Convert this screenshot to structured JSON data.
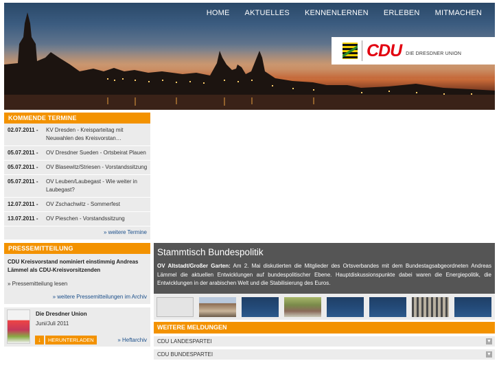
{
  "nav": [
    "HOME",
    "AKTUELLES",
    "KENNENLERNEN",
    "ERLEBEN",
    "MITMACHEN"
  ],
  "logo": {
    "brand": "CDU",
    "subtitle": "DIE DRESDNER UNION"
  },
  "colors": {
    "accent": "#f39200",
    "brand_red": "#e2000f",
    "link": "#1a4e8a",
    "panel": "#ebebeb",
    "dark_panel": "#555555"
  },
  "termine": {
    "heading": "KOMMENDE TERMINE",
    "items": [
      {
        "date": "02.07.2011 -",
        "text": "KV Dresden - Kreisparteitag mit Neuwahlen des Kreisvorstan…"
      },
      {
        "date": "05.07.2011 -",
        "text": "OV Dresdner Sueden - Ortsbeirat Plauen"
      },
      {
        "date": "05.07.2011 -",
        "text": "OV Blasewitz/Striesen - Vorstandssitzung"
      },
      {
        "date": "05.07.2011 -",
        "text": "OV Leuben/Laubegast - Wie weiter in Laubegast?"
      },
      {
        "date": "12.07.2011 -",
        "text": "OV Zschachwitz - Sommerfest"
      },
      {
        "date": "13.07.2011 -",
        "text": "OV Pieschen - Vorstandssitzung"
      }
    ],
    "more": "» weitere Termine"
  },
  "presse": {
    "heading": "PRESSEMITTEILUNG",
    "title": "CDU Kreisvorstand nominiert einstimmig Andreas Lämmel als CDU-Kreisvorsitzenden",
    "read": "» Pressemitteilung lesen",
    "more": "» weitere Pressemitteilungen im Archiv"
  },
  "magazin": {
    "title": "Die Dresdner Union",
    "issue": "Juni/Juli 2011",
    "download": "HERUNTERLADEN",
    "archive": "» Heftarchiv"
  },
  "feature": {
    "title": "Stammtisch Bundespolitik",
    "lead": "OV Altstadt/Großer Garten:",
    "text": " Am 2. Mai diskutierten die Mitglieder des Ortsverbandes mit dem Bundestagsabgeordneten Andreas Lämmel die aktuellen Entwicklungen auf bundespolitischer Ebene. Hauptdiskussionspunkte dabei waren die Energiepolitik, die Entwicklungen in der arabischen Welt und die Stabilisierung des Euros."
  },
  "meldungen": {
    "heading": "WEITERE MELDUNGEN",
    "items": [
      "CDU LANDESPARTEI",
      "CDU BUNDESPARTEI"
    ]
  }
}
